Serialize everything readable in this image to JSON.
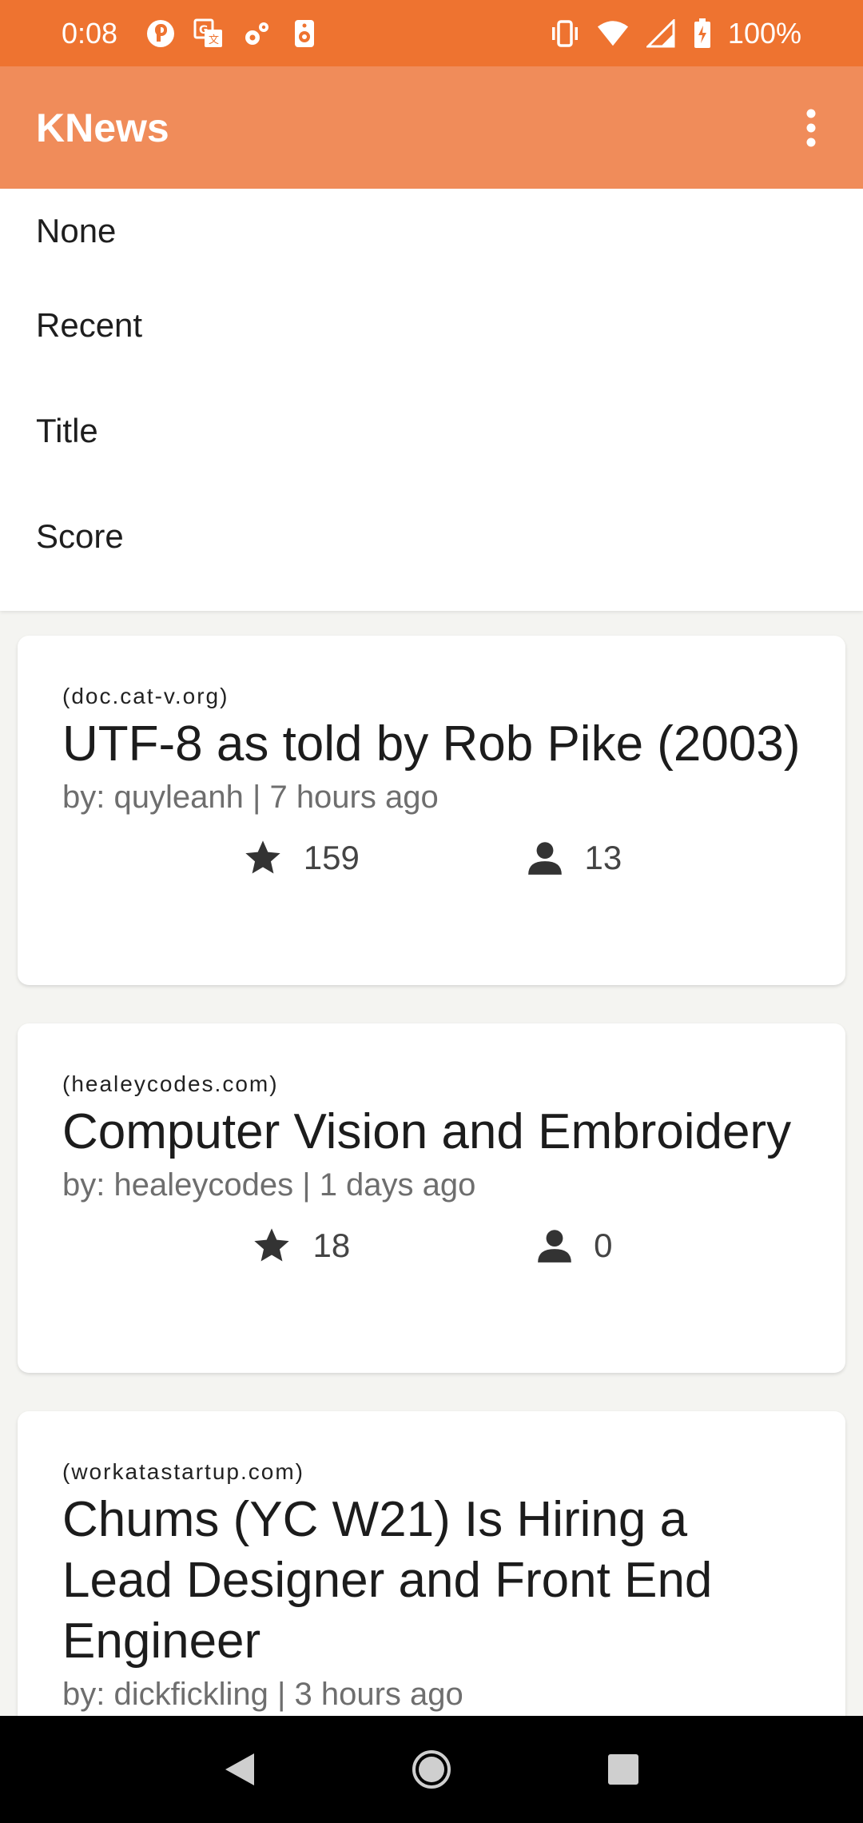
{
  "status_bar": {
    "time": "0:08",
    "battery_pct": "100%",
    "left_icons": [
      "notification-icon",
      "translate-icon",
      "settings-gear-icon",
      "speaker-icon"
    ],
    "right_icons": [
      "vibrate-icon",
      "wifi-icon",
      "signal-icon",
      "battery-charging-icon"
    ]
  },
  "app_bar": {
    "title": "KNews",
    "menu_icon": "more-vert-icon"
  },
  "sort_menu": {
    "items": [
      {
        "label": "None"
      },
      {
        "label": "Recent"
      },
      {
        "label": "Title"
      },
      {
        "label": "Score"
      }
    ]
  },
  "stories": [
    {
      "domain": "(doc.cat-v.org)",
      "title": "UTF-8 as told by Rob Pike (2003)",
      "meta": "by: quyleanh | 7 hours ago",
      "score": "159",
      "comments": "13"
    },
    {
      "domain": "(healeycodes.com)",
      "title": "Computer Vision and Embroidery",
      "meta": "by: healeycodes | 1 days ago",
      "score": "18",
      "comments": "0"
    },
    {
      "domain": "(workatastartup.com)",
      "title": "Chums (YC W21) Is Hiring a Lead Designer and Front End Engineer",
      "meta": "by: dickfickling | 3 hours ago",
      "score": "",
      "comments": ""
    }
  ],
  "nav_bar": {
    "icons": [
      "back-icon",
      "home-icon",
      "recents-icon"
    ]
  },
  "colors": {
    "status_bar": "#ee7330",
    "app_bar": "#f08c5a",
    "background": "#f4f4f1"
  }
}
